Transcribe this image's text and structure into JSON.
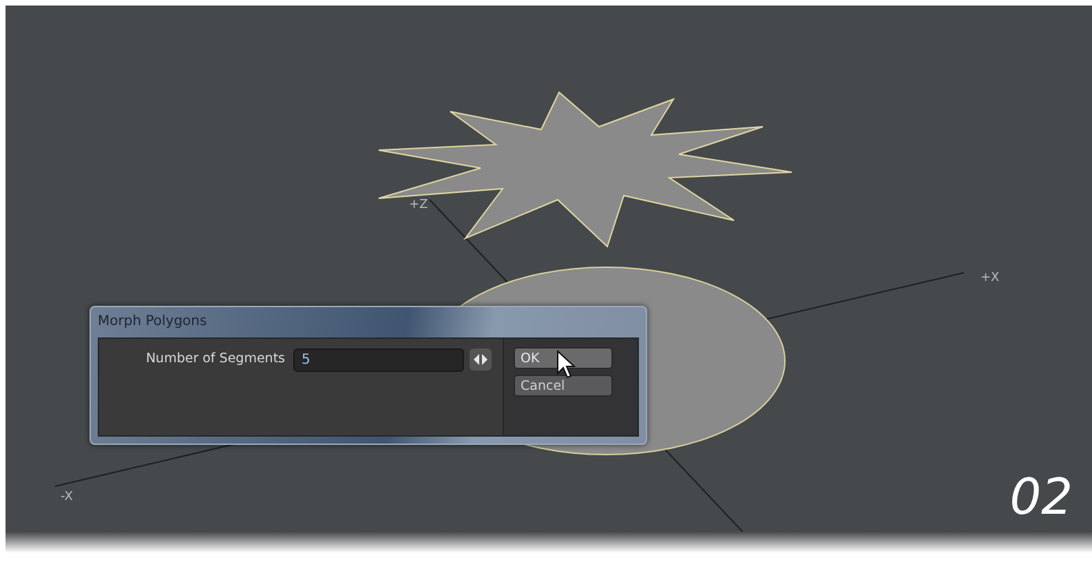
{
  "viewport": {
    "axis_labels": [
      {
        "kind": "z",
        "text": "+Z"
      },
      {
        "kind": "x_pos",
        "text": "+X"
      },
      {
        "kind": "x_neg",
        "text": "-X"
      }
    ],
    "step_number": "02"
  },
  "dialog": {
    "title": "Morph Polygons",
    "field": {
      "label": "Number of Segments",
      "value": "5"
    },
    "buttons": [
      {
        "label": "OK",
        "hovered": true
      },
      {
        "label": "Cancel",
        "hovered": false
      }
    ]
  }
}
